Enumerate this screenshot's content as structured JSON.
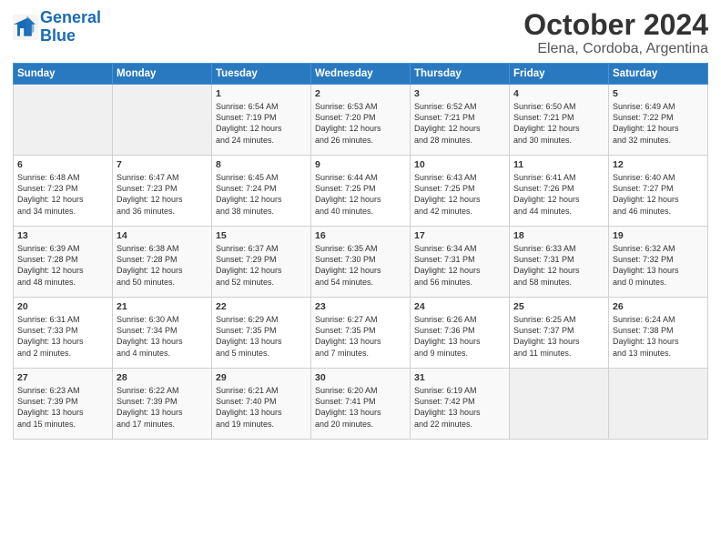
{
  "logo": {
    "line1": "General",
    "line2": "Blue"
  },
  "title": "October 2024",
  "subtitle": "Elena, Cordoba, Argentina",
  "days_of_week": [
    "Sunday",
    "Monday",
    "Tuesday",
    "Wednesday",
    "Thursday",
    "Friday",
    "Saturday"
  ],
  "weeks": [
    [
      {
        "day": "",
        "content": ""
      },
      {
        "day": "",
        "content": ""
      },
      {
        "day": "1",
        "content": "Sunrise: 6:54 AM\nSunset: 7:19 PM\nDaylight: 12 hours\nand 24 minutes."
      },
      {
        "day": "2",
        "content": "Sunrise: 6:53 AM\nSunset: 7:20 PM\nDaylight: 12 hours\nand 26 minutes."
      },
      {
        "day": "3",
        "content": "Sunrise: 6:52 AM\nSunset: 7:21 PM\nDaylight: 12 hours\nand 28 minutes."
      },
      {
        "day": "4",
        "content": "Sunrise: 6:50 AM\nSunset: 7:21 PM\nDaylight: 12 hours\nand 30 minutes."
      },
      {
        "day": "5",
        "content": "Sunrise: 6:49 AM\nSunset: 7:22 PM\nDaylight: 12 hours\nand 32 minutes."
      }
    ],
    [
      {
        "day": "6",
        "content": "Sunrise: 6:48 AM\nSunset: 7:23 PM\nDaylight: 12 hours\nand 34 minutes."
      },
      {
        "day": "7",
        "content": "Sunrise: 6:47 AM\nSunset: 7:23 PM\nDaylight: 12 hours\nand 36 minutes."
      },
      {
        "day": "8",
        "content": "Sunrise: 6:45 AM\nSunset: 7:24 PM\nDaylight: 12 hours\nand 38 minutes."
      },
      {
        "day": "9",
        "content": "Sunrise: 6:44 AM\nSunset: 7:25 PM\nDaylight: 12 hours\nand 40 minutes."
      },
      {
        "day": "10",
        "content": "Sunrise: 6:43 AM\nSunset: 7:25 PM\nDaylight: 12 hours\nand 42 minutes."
      },
      {
        "day": "11",
        "content": "Sunrise: 6:41 AM\nSunset: 7:26 PM\nDaylight: 12 hours\nand 44 minutes."
      },
      {
        "day": "12",
        "content": "Sunrise: 6:40 AM\nSunset: 7:27 PM\nDaylight: 12 hours\nand 46 minutes."
      }
    ],
    [
      {
        "day": "13",
        "content": "Sunrise: 6:39 AM\nSunset: 7:28 PM\nDaylight: 12 hours\nand 48 minutes."
      },
      {
        "day": "14",
        "content": "Sunrise: 6:38 AM\nSunset: 7:28 PM\nDaylight: 12 hours\nand 50 minutes."
      },
      {
        "day": "15",
        "content": "Sunrise: 6:37 AM\nSunset: 7:29 PM\nDaylight: 12 hours\nand 52 minutes."
      },
      {
        "day": "16",
        "content": "Sunrise: 6:35 AM\nSunset: 7:30 PM\nDaylight: 12 hours\nand 54 minutes."
      },
      {
        "day": "17",
        "content": "Sunrise: 6:34 AM\nSunset: 7:31 PM\nDaylight: 12 hours\nand 56 minutes."
      },
      {
        "day": "18",
        "content": "Sunrise: 6:33 AM\nSunset: 7:31 PM\nDaylight: 12 hours\nand 58 minutes."
      },
      {
        "day": "19",
        "content": "Sunrise: 6:32 AM\nSunset: 7:32 PM\nDaylight: 13 hours\nand 0 minutes."
      }
    ],
    [
      {
        "day": "20",
        "content": "Sunrise: 6:31 AM\nSunset: 7:33 PM\nDaylight: 13 hours\nand 2 minutes."
      },
      {
        "day": "21",
        "content": "Sunrise: 6:30 AM\nSunset: 7:34 PM\nDaylight: 13 hours\nand 4 minutes."
      },
      {
        "day": "22",
        "content": "Sunrise: 6:29 AM\nSunset: 7:35 PM\nDaylight: 13 hours\nand 5 minutes."
      },
      {
        "day": "23",
        "content": "Sunrise: 6:27 AM\nSunset: 7:35 PM\nDaylight: 13 hours\nand 7 minutes."
      },
      {
        "day": "24",
        "content": "Sunrise: 6:26 AM\nSunset: 7:36 PM\nDaylight: 13 hours\nand 9 minutes."
      },
      {
        "day": "25",
        "content": "Sunrise: 6:25 AM\nSunset: 7:37 PM\nDaylight: 13 hours\nand 11 minutes."
      },
      {
        "day": "26",
        "content": "Sunrise: 6:24 AM\nSunset: 7:38 PM\nDaylight: 13 hours\nand 13 minutes."
      }
    ],
    [
      {
        "day": "27",
        "content": "Sunrise: 6:23 AM\nSunset: 7:39 PM\nDaylight: 13 hours\nand 15 minutes."
      },
      {
        "day": "28",
        "content": "Sunrise: 6:22 AM\nSunset: 7:39 PM\nDaylight: 13 hours\nand 17 minutes."
      },
      {
        "day": "29",
        "content": "Sunrise: 6:21 AM\nSunset: 7:40 PM\nDaylight: 13 hours\nand 19 minutes."
      },
      {
        "day": "30",
        "content": "Sunrise: 6:20 AM\nSunset: 7:41 PM\nDaylight: 13 hours\nand 20 minutes."
      },
      {
        "day": "31",
        "content": "Sunrise: 6:19 AM\nSunset: 7:42 PM\nDaylight: 13 hours\nand 22 minutes."
      },
      {
        "day": "",
        "content": ""
      },
      {
        "day": "",
        "content": ""
      }
    ]
  ]
}
